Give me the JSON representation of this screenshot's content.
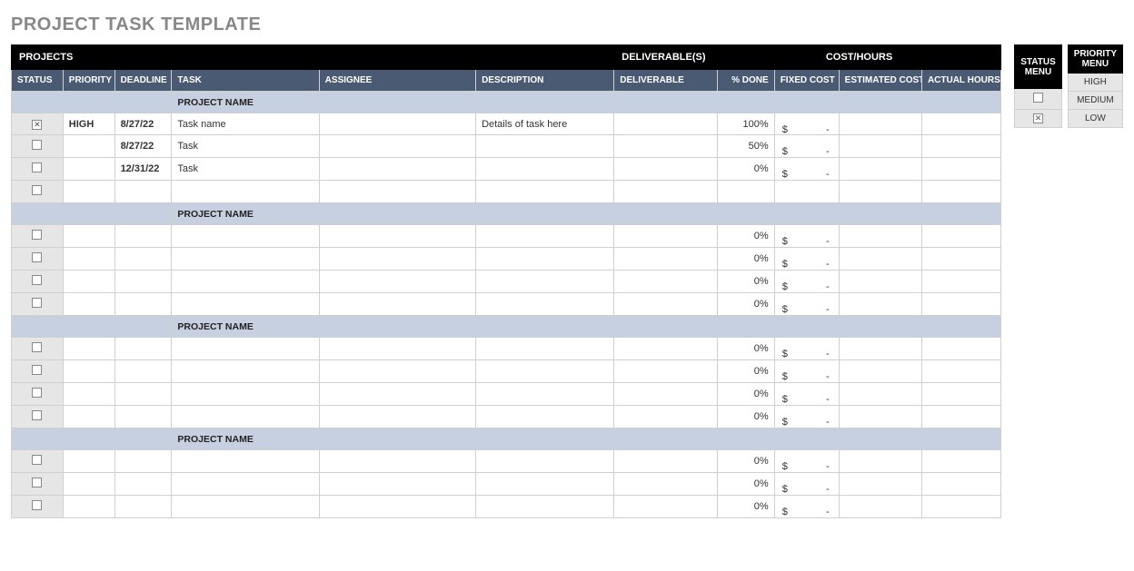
{
  "title": "PROJECT TASK TEMPLATE",
  "bands": {
    "projects": "PROJECTS",
    "deliverables": "DELIVERABLE(S)",
    "cost_hours": "COST/HOURS"
  },
  "cols": {
    "status": "STATUS",
    "priority": "PRIORITY",
    "deadline": "DEADLINE",
    "task": "TASK",
    "assignee": "ASSIGNEE",
    "description": "DESCRIPTION",
    "deliverable": "DELIVERABLE",
    "pct_done": "% DONE",
    "fixed_cost": "FIXED COST",
    "est_cost": "ESTIMATED COST",
    "actual_hours": "ACTUAL HOURS"
  },
  "project_label": "PROJECT NAME",
  "currency": "$",
  "dash": "-",
  "groups": [
    {
      "rows": [
        {
          "checked": true,
          "priority": "HIGH",
          "deadline": "8/27/22",
          "task": "Task name",
          "assignee": "",
          "description": "Details of task here",
          "deliverable": "",
          "pct": "100%",
          "fixed": true
        },
        {
          "checked": false,
          "priority": "",
          "deadline": "8/27/22",
          "task": "Task",
          "assignee": "",
          "description": "",
          "deliverable": "",
          "pct": "50%",
          "fixed": true
        },
        {
          "checked": false,
          "priority": "",
          "deadline": "12/31/22",
          "task": "Task",
          "assignee": "",
          "description": "",
          "deliverable": "",
          "pct": "0%",
          "fixed": true
        },
        {
          "checked": false,
          "priority": "",
          "deadline": "",
          "task": "",
          "assignee": "",
          "description": "",
          "deliverable": "",
          "pct": "",
          "fixed": false
        }
      ]
    },
    {
      "rows": [
        {
          "checked": false,
          "priority": "",
          "deadline": "",
          "task": "",
          "assignee": "",
          "description": "",
          "deliverable": "",
          "pct": "0%",
          "fixed": true
        },
        {
          "checked": false,
          "priority": "",
          "deadline": "",
          "task": "",
          "assignee": "",
          "description": "",
          "deliverable": "",
          "pct": "0%",
          "fixed": true
        },
        {
          "checked": false,
          "priority": "",
          "deadline": "",
          "task": "",
          "assignee": "",
          "description": "",
          "deliverable": "",
          "pct": "0%",
          "fixed": true
        },
        {
          "checked": false,
          "priority": "",
          "deadline": "",
          "task": "",
          "assignee": "",
          "description": "",
          "deliverable": "",
          "pct": "0%",
          "fixed": true
        }
      ]
    },
    {
      "rows": [
        {
          "checked": false,
          "priority": "",
          "deadline": "",
          "task": "",
          "assignee": "",
          "description": "",
          "deliverable": "",
          "pct": "0%",
          "fixed": true
        },
        {
          "checked": false,
          "priority": "",
          "deadline": "",
          "task": "",
          "assignee": "",
          "description": "",
          "deliverable": "",
          "pct": "0%",
          "fixed": true
        },
        {
          "checked": false,
          "priority": "",
          "deadline": "",
          "task": "",
          "assignee": "",
          "description": "",
          "deliverable": "",
          "pct": "0%",
          "fixed": true
        },
        {
          "checked": false,
          "priority": "",
          "deadline": "",
          "task": "",
          "assignee": "",
          "description": "",
          "deliverable": "",
          "pct": "0%",
          "fixed": true
        }
      ]
    },
    {
      "rows": [
        {
          "checked": false,
          "priority": "",
          "deadline": "",
          "task": "",
          "assignee": "",
          "description": "",
          "deliverable": "",
          "pct": "0%",
          "fixed": true
        },
        {
          "checked": false,
          "priority": "",
          "deadline": "",
          "task": "",
          "assignee": "",
          "description": "",
          "deliverable": "",
          "pct": "0%",
          "fixed": true
        },
        {
          "checked": false,
          "priority": "",
          "deadline": "",
          "task": "",
          "assignee": "",
          "description": "",
          "deliverable": "",
          "pct": "0%",
          "fixed": true
        }
      ]
    }
  ],
  "status_menu": {
    "title1": "STATUS",
    "title2": "MENU",
    "r1_checked": false,
    "r2_checked": true
  },
  "priority_menu": {
    "title1": "PRIORITY",
    "title2": "MENU",
    "r1": "HIGH",
    "r2": "MEDIUM",
    "r3": "LOW"
  }
}
